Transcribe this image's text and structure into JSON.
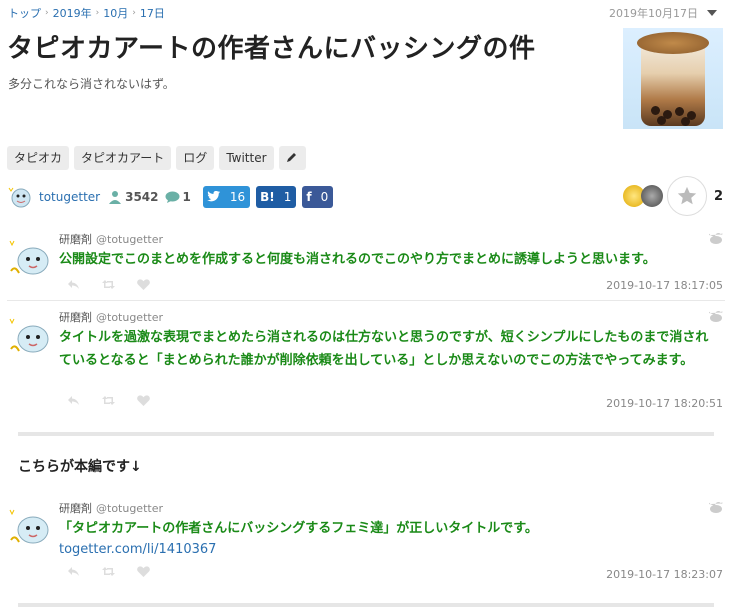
{
  "breadcrumb": [
    {
      "label": "トップ"
    },
    {
      "label": "2019年"
    },
    {
      "label": "10月"
    },
    {
      "label": "17日"
    }
  ],
  "post_date": "2019年10月17日",
  "title": "タピオカアートの作者さんにバッシングの件",
  "subtitle": "多分これなら消されないはず。",
  "tags": [
    "タピオカ",
    "タピオカアート",
    "ログ",
    "Twitter"
  ],
  "meta": {
    "author": "totugetter",
    "views": "3542",
    "comments": "1",
    "tweet_count": "16",
    "hatena_label": "B!",
    "hatena_count": "1",
    "facebook_count": "0",
    "favorite_count": "2"
  },
  "tweets": [
    {
      "name": "研磨剤",
      "handle": "@totugetter",
      "text": "公開設定でこのまとめを作成すると何度も消されるのでこのやり方でまとめに誘導しようと思います。",
      "link": "",
      "time": "2019-10-17 18:17:05"
    },
    {
      "name": "研磨剤",
      "handle": "@totugetter",
      "text": "タイトルを過激な表現でまとめたら消されるのは仕方ないと思うのですが、短くシンプルにしたものまで消されているとなると「まとめられた誰かが削除依頼を出している」としか思えないのでこの方法でやってみます。",
      "link": "",
      "time": "2019-10-17 18:20:51"
    },
    {
      "name": "研磨剤",
      "handle": "@totugetter",
      "text": "「タピオカアートの作者さんにバッシングするフェミ達」が正しいタイトルです。",
      "link": "togetter.com/li/1410367",
      "time": "2019-10-17 18:23:07"
    }
  ],
  "section_heading": "こちらが本編です↓",
  "colors": {
    "link": "#2a6fb0",
    "tweet_text": "#1a8a17",
    "twitter": "#2f93d8",
    "hatena": "#1f5da4",
    "facebook": "#3b5998"
  }
}
